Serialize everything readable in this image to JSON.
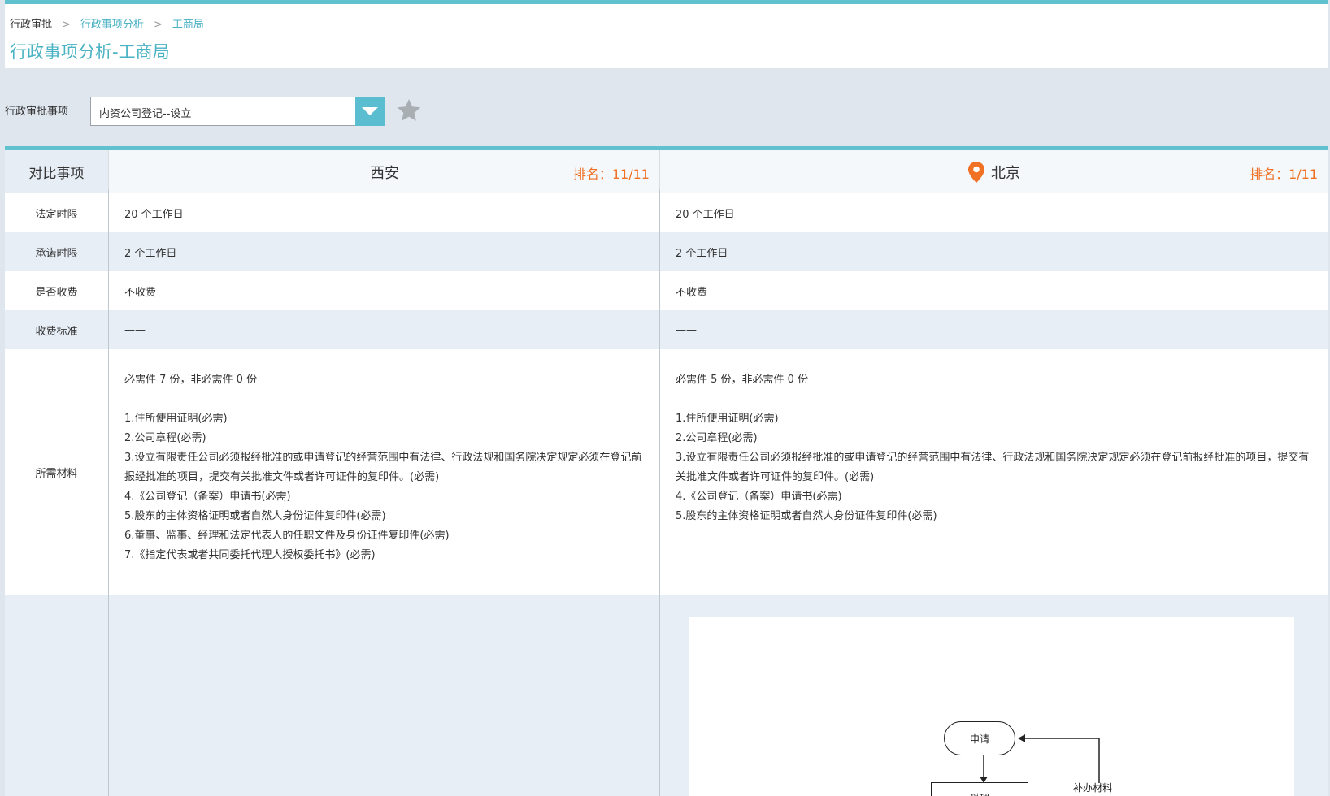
{
  "breadcrumb": [
    "行政审批",
    "行政事项分析",
    "工商局"
  ],
  "breadcrumb_sep": ">",
  "page_title": "行政事项分析-工商局",
  "filter": {
    "label": "行政审批事项",
    "selected": "内资公司登记--设立"
  },
  "compare": {
    "header_label": "对比事项",
    "cities": [
      {
        "name": "西安",
        "rank": "排名：11/11",
        "has_location_icon": false
      },
      {
        "name": "北京",
        "rank": "排名：1/11",
        "has_location_icon": true
      }
    ],
    "rows": [
      {
        "label": "法定时限",
        "values": [
          "20 个工作日",
          "20 个工作日"
        ]
      },
      {
        "label": "承诺时限",
        "values": [
          "2 个工作日",
          "2 个工作日"
        ]
      },
      {
        "label": "是否收费",
        "values": [
          "不收费",
          "不收费"
        ]
      },
      {
        "label": "收费标准",
        "values": [
          "——",
          "——"
        ]
      }
    ],
    "materials": {
      "label": "所需材料",
      "xian": {
        "summary": "必需件 7 份，非必需件 0 份",
        "items": [
          "1.住所使用证明(必需)",
          "2.公司章程(必需)",
          "3.设立有限责任公司必须报经批准的或申请登记的经营范围中有法律、行政法规和国务院决定规定必须在登记前报经批准的项目，提交有关批准文件或者许可证件的复印件。(必需)",
          "4.《公司登记（备案）申请书(必需)",
          "5.股东的主体资格证明或者自然人身份证件复印件(必需)",
          "6.董事、监事、经理和法定代表人的任职文件及身份证件复印件(必需)",
          "7.《指定代表或者共同委托代理人授权委托书》(必需)"
        ]
      },
      "beijing": {
        "summary": "必需件 5 份，非必需件 0 份",
        "items": [
          "1.住所使用证明(必需)",
          "2.公司章程(必需)",
          "3.设立有限责任公司必须报经批准的或申请登记的经营范围中有法律、行政法规和国务院决定规定必须在登记前报经批准的项目，提交有关批准文件或者许可证件的复印件。(必需)",
          "4.《公司登记（备案）申请书(必需)",
          "5.股东的主体资格证明或者自然人身份证件复印件(必需)"
        ]
      }
    }
  },
  "flowchart": {
    "node_apply": "申请",
    "node_accept": "受理",
    "note": "补办材料"
  },
  "colors": {
    "accent": "#62c1cf",
    "link": "#49b2c3",
    "rank": "#f07024",
    "row_alt": "#e7eef6",
    "page_bg": "#dfe6ee"
  },
  "icons": {
    "dropdown": "chevron-down-icon",
    "favorite": "star-icon",
    "location": "map-pin-icon"
  }
}
